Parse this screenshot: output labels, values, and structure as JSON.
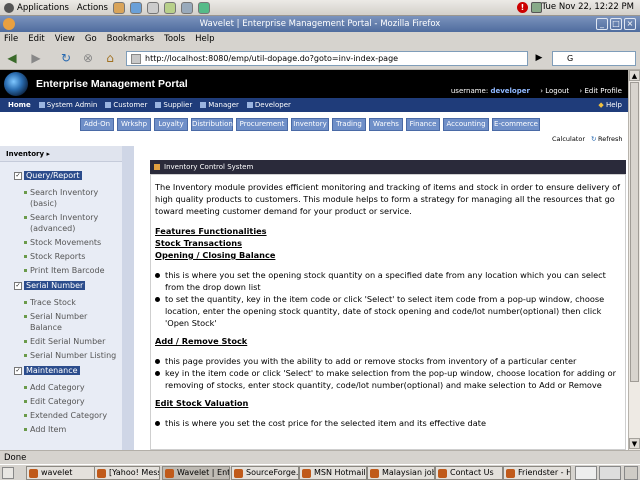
{
  "system_panel": {
    "menus": [
      "Applications",
      "Actions"
    ],
    "clock": "Tue Nov 22, 12:22 PM"
  },
  "window": {
    "title": "Wavelet | Enterprise Management Portal - Mozilla Firefox"
  },
  "menubar": [
    "File",
    "Edit",
    "View",
    "Go",
    "Bookmarks",
    "Tools",
    "Help"
  ],
  "navigation": {
    "url": "http://localhost:8080/emp/util-dopage.do?goto=inv-index-page",
    "search_value": "G"
  },
  "portal": {
    "title": "Enterprise Management Portal",
    "username_label": "username:",
    "username": "developer",
    "logout": "› Logout",
    "edit_profile": "› Edit Profile",
    "main_nav": [
      "Home",
      "System Admin",
      "Customer",
      "Supplier",
      "Manager",
      "Developer"
    ],
    "help": "Help",
    "module_tabs": [
      "Add-On",
      "Wrkshp",
      "Loyalty",
      "Distribution",
      "Procurement",
      "Inventory",
      "Trading",
      "Warehs",
      "Finance",
      "Accounting",
      "E-commerce"
    ],
    "calculator": "Calculator",
    "refresh": "Refresh"
  },
  "sidebar": {
    "heading": "Inventory",
    "sections": [
      {
        "label": "Query/Report",
        "items": [
          "Search Inventory (basic)",
          "Search Inventory (advanced)",
          "Stock Movements",
          "Stock Reports",
          "Print Item Barcode"
        ]
      },
      {
        "label": "Serial Number",
        "items": [
          "Trace Stock",
          "Serial Number Balance",
          "Edit Serial Number",
          "Serial Number Listing"
        ]
      },
      {
        "label": "Maintenance",
        "items": [
          "Add Category",
          "Edit Category",
          "Extended Category",
          "Add Item"
        ]
      }
    ]
  },
  "content": {
    "title": "Inventory Control System",
    "intro": "The Inventory module provides efficient monitoring and tracking of items and stock in order to ensure delivery of high quality products to customers. This module helps to form a strategy for managing all the resources that go toward meeting customer demand for your product or service.",
    "features_heading": "Features   Functionalities",
    "stock_transactions": "Stock Transactions",
    "opening_closing": "Opening / Closing Balance",
    "oc_bullet1": "this is where you set the opening stock quantity on a specified date from any location which you can select from the drop down list",
    "oc_bullet2": "to set the quantity, key in the item code or click 'Select' to select item code from a pop-up window, choose location, enter the opening stock quantity, date of stock opening and code/lot number(optional) then click 'Open Stock'",
    "add_remove": "Add / Remove Stock",
    "ar_bullet1": "this page provides you with the ability to add or remove stocks from inventory of a particular center",
    "ar_bullet2": "key in the item code or click 'Select' to make selection from the pop-up window, choose location for adding or removing of stocks, enter stock quantity, code/lot number(optional) and make selection to Add or Remove",
    "edit_valuation": "Edit Stock Valuation",
    "ev_bullet1": "this is where you set the cost price for the selected item and its effective date"
  },
  "status": "Done",
  "taskbar": [
    "wavelet",
    "[Yahoo! Mess",
    "Wavelet | Ent",
    "SourceForge.r",
    "MSN Hotmail",
    "Malaysian job",
    "Contact Us",
    "Friendster - Ho"
  ]
}
